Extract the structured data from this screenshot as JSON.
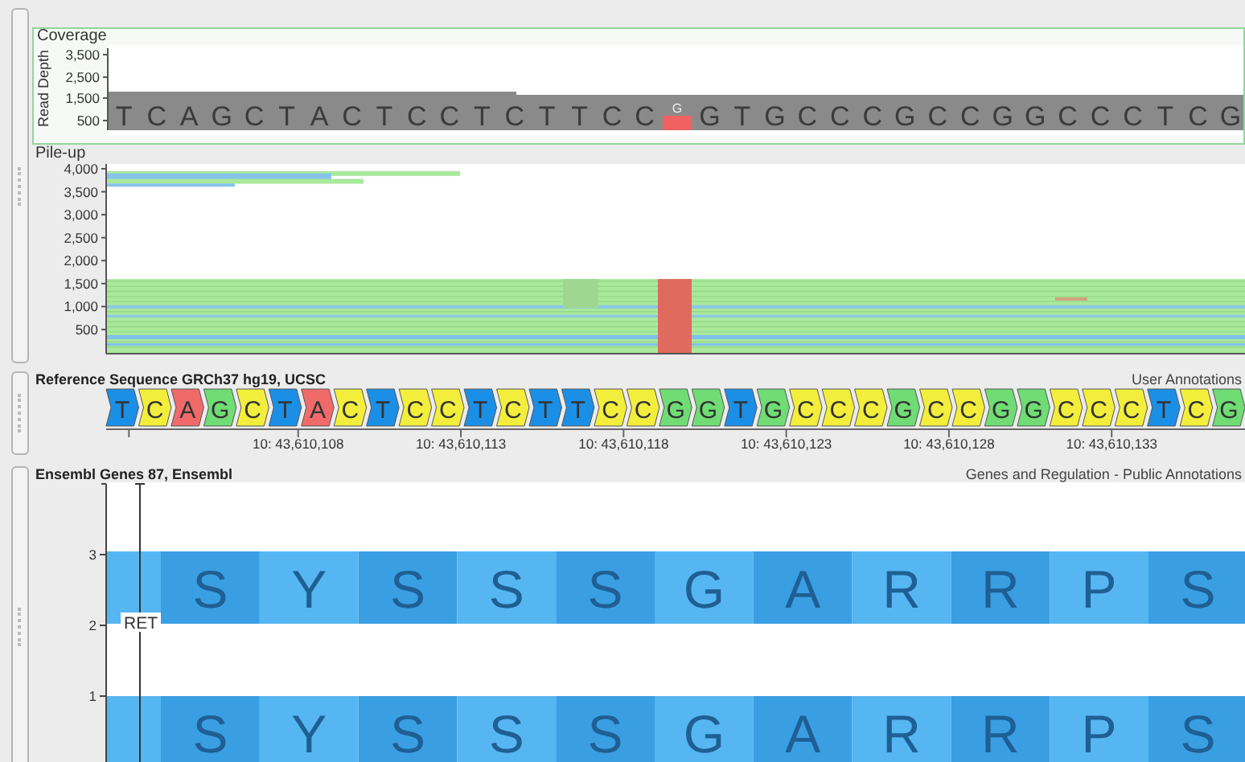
{
  "coverage": {
    "title": "Coverage",
    "axis_label": "Read Depth",
    "y_ticks": [
      "3,500",
      "2,500",
      "1,500",
      "500"
    ],
    "bases": [
      {
        "base": "T",
        "variant": false
      },
      {
        "base": "C",
        "variant": false
      },
      {
        "base": "A",
        "variant": false
      },
      {
        "base": "G",
        "variant": false
      },
      {
        "base": "C",
        "variant": false
      },
      {
        "base": "T",
        "variant": false
      },
      {
        "base": "A",
        "variant": false
      },
      {
        "base": "C",
        "variant": false
      },
      {
        "base": "T",
        "variant": false
      },
      {
        "base": "C",
        "variant": false
      },
      {
        "base": "C",
        "variant": false
      },
      {
        "base": "T",
        "variant": false
      },
      {
        "base": "C",
        "variant": false
      },
      {
        "base": "T",
        "variant": false
      },
      {
        "base": "T",
        "variant": false
      },
      {
        "base": "C",
        "variant": false
      },
      {
        "base": "C",
        "variant": false
      },
      {
        "base": "G",
        "variant": true
      },
      {
        "base": "G",
        "variant": false
      },
      {
        "base": "T",
        "variant": false
      },
      {
        "base": "G",
        "variant": false
      },
      {
        "base": "C",
        "variant": false
      },
      {
        "base": "C",
        "variant": false
      },
      {
        "base": "C",
        "variant": false
      },
      {
        "base": "G",
        "variant": false
      },
      {
        "base": "C",
        "variant": false
      },
      {
        "base": "C",
        "variant": false
      },
      {
        "base": "G",
        "variant": false
      },
      {
        "base": "G",
        "variant": false
      },
      {
        "base": "C",
        "variant": false
      },
      {
        "base": "C",
        "variant": false
      },
      {
        "base": "C",
        "variant": false
      },
      {
        "base": "T",
        "variant": false
      },
      {
        "base": "C",
        "variant": false
      },
      {
        "base": "G",
        "variant": false
      }
    ]
  },
  "pileup": {
    "title": "Pile-up",
    "y_ticks": [
      "4,000",
      "3,500",
      "3,000",
      "2,500",
      "2,000",
      "1,500",
      "1,000",
      "500"
    ]
  },
  "reference": {
    "title": "Reference Sequence GRCh37 hg19, UCSC",
    "group": "User Annotations",
    "bases": [
      {
        "base": "T",
        "color": "#1b8fe6"
      },
      {
        "base": "C",
        "color": "#f3ee3c"
      },
      {
        "base": "A",
        "color": "#f06a6a"
      },
      {
        "base": "G",
        "color": "#70dc74"
      },
      {
        "base": "C",
        "color": "#f3ee3c"
      },
      {
        "base": "T",
        "color": "#1b8fe6"
      },
      {
        "base": "A",
        "color": "#f06a6a"
      },
      {
        "base": "C",
        "color": "#f3ee3c"
      },
      {
        "base": "T",
        "color": "#1b8fe6"
      },
      {
        "base": "C",
        "color": "#f3ee3c"
      },
      {
        "base": "C",
        "color": "#f3ee3c"
      },
      {
        "base": "T",
        "color": "#1b8fe6"
      },
      {
        "base": "C",
        "color": "#f3ee3c"
      },
      {
        "base": "T",
        "color": "#1b8fe6"
      },
      {
        "base": "T",
        "color": "#1b8fe6"
      },
      {
        "base": "C",
        "color": "#f3ee3c"
      },
      {
        "base": "C",
        "color": "#f3ee3c"
      },
      {
        "base": "G",
        "color": "#70dc74"
      },
      {
        "base": "G",
        "color": "#70dc74"
      },
      {
        "base": "T",
        "color": "#1b8fe6"
      },
      {
        "base": "G",
        "color": "#70dc74"
      },
      {
        "base": "C",
        "color": "#f3ee3c"
      },
      {
        "base": "C",
        "color": "#f3ee3c"
      },
      {
        "base": "C",
        "color": "#f3ee3c"
      },
      {
        "base": "G",
        "color": "#70dc74"
      },
      {
        "base": "C",
        "color": "#f3ee3c"
      },
      {
        "base": "C",
        "color": "#f3ee3c"
      },
      {
        "base": "G",
        "color": "#70dc74"
      },
      {
        "base": "G",
        "color": "#70dc74"
      },
      {
        "base": "C",
        "color": "#f3ee3c"
      },
      {
        "base": "C",
        "color": "#f3ee3c"
      },
      {
        "base": "C",
        "color": "#f3ee3c"
      },
      {
        "base": "T",
        "color": "#1b8fe6"
      },
      {
        "base": "C",
        "color": "#f3ee3c"
      },
      {
        "base": "G",
        "color": "#70dc74"
      }
    ],
    "ticks": [
      "10: 43,610,108",
      "10: 43,610,113",
      "10: 43,610,118",
      "10: 43,610,123",
      "10: 43,610,128",
      "10: 43,610,133"
    ]
  },
  "genes": {
    "title": "Ensembl Genes 87, Ensembl",
    "group": "Genes and Regulation - Public Annotations",
    "y_ticks": [
      "3",
      "2",
      "1"
    ],
    "gene_label": "RET",
    "frames": [
      {
        "cells": [
          {
            "color": "#55b6f2"
          },
          {
            "aa": "S",
            "color": "#3a9ee2"
          },
          {
            "aa": "Y",
            "color": "#55b6f2"
          },
          {
            "aa": "S",
            "color": "#3a9ee2"
          },
          {
            "aa": "S",
            "color": "#55b6f2"
          },
          {
            "aa": "S",
            "color": "#3a9ee2"
          },
          {
            "aa": "G",
            "color": "#55b6f2"
          },
          {
            "aa": "A",
            "color": "#3a9ee2"
          },
          {
            "aa": "R",
            "color": "#55b6f2"
          },
          {
            "aa": "R",
            "color": "#3a9ee2"
          },
          {
            "aa": "P",
            "color": "#55b6f2"
          },
          {
            "aa": "S",
            "color": "#3a9ee2"
          }
        ]
      },
      {
        "cells": [
          {
            "color": "#55b6f2"
          },
          {
            "aa": "S",
            "color": "#3a9ee2"
          },
          {
            "aa": "Y",
            "color": "#55b6f2"
          },
          {
            "aa": "S",
            "color": "#3a9ee2"
          },
          {
            "aa": "S",
            "color": "#55b6f2"
          },
          {
            "aa": "S",
            "color": "#3a9ee2"
          },
          {
            "aa": "G",
            "color": "#55b6f2"
          },
          {
            "aa": "A",
            "color": "#3a9ee2"
          },
          {
            "aa": "R",
            "color": "#55b6f2"
          },
          {
            "aa": "R",
            "color": "#3a9ee2"
          },
          {
            "aa": "P",
            "color": "#55b6f2"
          },
          {
            "aa": "S",
            "color": "#3a9ee2"
          }
        ]
      }
    ]
  }
}
